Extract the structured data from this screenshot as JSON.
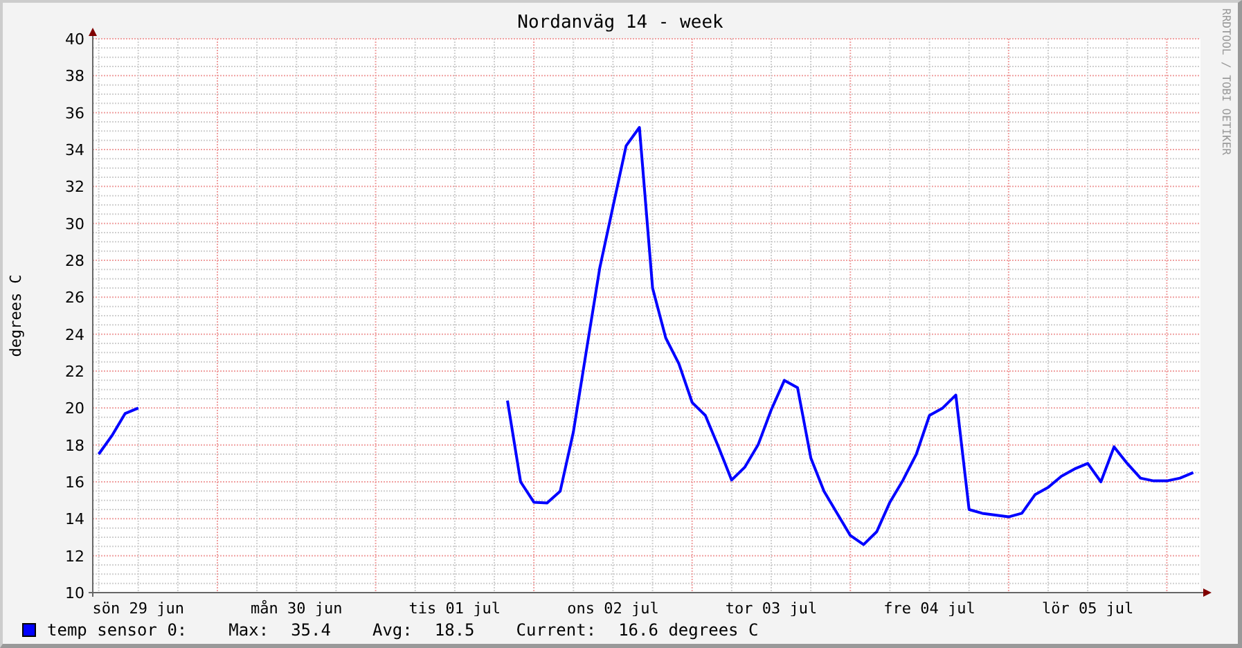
{
  "graph": {
    "credit": "RRDTOOL / TOBI OETIKER",
    "chart_data": {
      "type": "line",
      "title": "Nordanväg 14 - week",
      "ylabel": "degrees C",
      "categories": [
        null,
        null,
        null,
        "sön 29 jun",
        null,
        null,
        null,
        null,
        null,
        null,
        null,
        null,
        null,
        null,
        null,
        "mån 30 jun",
        null,
        null,
        null,
        null,
        null,
        null,
        null,
        null,
        null,
        null,
        null,
        "tis 01 jul",
        null,
        null,
        null,
        null,
        null,
        null,
        null,
        null,
        null,
        null,
        null,
        "ons 02 jul",
        null,
        null,
        null,
        null,
        null,
        null,
        null,
        null,
        null,
        null,
        null,
        "tor 03 jul",
        null,
        null,
        null,
        null,
        null,
        null,
        null,
        null,
        null,
        null,
        null,
        "fre 04 jul",
        null,
        null,
        null,
        null,
        null,
        null,
        null,
        null,
        null,
        null,
        null,
        "lör 05 jul",
        null,
        null,
        null,
        null,
        null,
        null,
        null,
        null
      ],
      "series": [
        {
          "name": "temp sensor 0:",
          "color": "#0000ff",
          "values": [
            17.5,
            18.5,
            19.7,
            20.0,
            null,
            null,
            null,
            null,
            null,
            null,
            null,
            null,
            null,
            null,
            null,
            null,
            null,
            null,
            null,
            null,
            null,
            null,
            null,
            null,
            null,
            null,
            null,
            null,
            null,
            null,
            null,
            20.4,
            16,
            14.9,
            14.85,
            15.5,
            18.7,
            23.2,
            27.6,
            30.9,
            34.2,
            35.2,
            26.5,
            23.8,
            22.4,
            20.3,
            19.6,
            17.9,
            16.1,
            16.8,
            18,
            19.9,
            21.5,
            21.1,
            17.3,
            15.5,
            14.3,
            13.1,
            12.6,
            13.3,
            14.9,
            16.1,
            17.5,
            19.6,
            20,
            20.7,
            14.5,
            14.3,
            14.2,
            14.1,
            14.3,
            15.3,
            15.7,
            16.3,
            16.7,
            17,
            16,
            17.9,
            17,
            16.2,
            16.05,
            16.05,
            16.2,
            16.5
          ]
        }
      ],
      "grid": true,
      "ylim": [
        10,
        40
      ],
      "yticks": [
        10,
        12,
        14,
        16,
        18,
        20,
        22,
        24,
        26,
        28,
        30,
        32,
        34,
        36,
        38,
        40
      ]
    }
  },
  "legend": {
    "stats": [
      {
        "label": "Max:",
        "value": "35.4"
      },
      {
        "label": "Avg:",
        "value": "18.5"
      },
      {
        "label": "Current:",
        "value": "16.6 degrees C"
      }
    ]
  }
}
